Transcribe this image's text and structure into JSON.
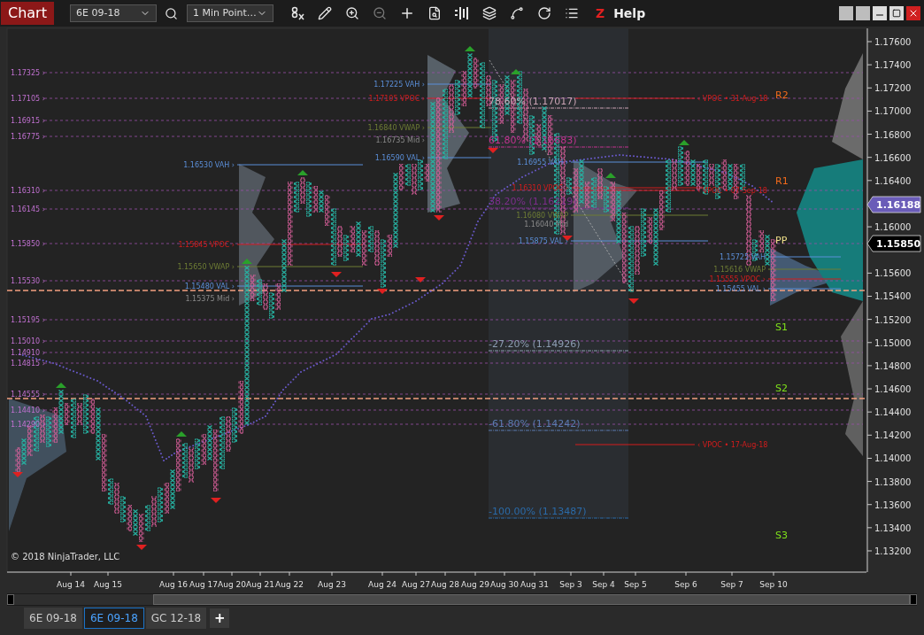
{
  "toolbar": {
    "title": "Chart",
    "instrument": "6E 09-18",
    "interval": "1 Min Point…",
    "menu_mark": "Z",
    "help": "Help"
  },
  "levels": [
    {
      "label": "1.17325 ›"
    },
    {
      "label": "1.17105 ›"
    },
    {
      "label": "1.16915 ›"
    },
    {
      "label": "1.16775 ›"
    },
    {
      "label": "1.16310 ›"
    },
    {
      "label": "1.16145 ›"
    },
    {
      "label": "1.15850 ›"
    },
    {
      "label": "1.15530 ›"
    },
    {
      "label": "1.15195 ›"
    },
    {
      "label": "1.15010 ›"
    },
    {
      "label": "1.14910 ›"
    },
    {
      "label": "1.14815 ›"
    },
    {
      "label": "1.14555 ›"
    },
    {
      "label": "1.14410 ›"
    },
    {
      "label": "1.14290 ›"
    }
  ],
  "sessions": [
    {
      "labels": [
        {
          "kind": "vah",
          "text": "1.16530 VAH ›"
        },
        {
          "kind": "vpoc",
          "text": "1.15845 VPOC ›"
        },
        {
          "kind": "vwap",
          "text": "1.15650 VWAP ›"
        },
        {
          "kind": "val",
          "text": "1.15480 VAL ›"
        },
        {
          "kind": "mid",
          "text": "1.15375 Mid ›"
        }
      ]
    },
    {
      "labels": [
        {
          "kind": "vah",
          "text": "1.17225 VAH ›"
        },
        {
          "kind": "vpoc",
          "text": "1.17105 VPOC ›"
        },
        {
          "kind": "vwap",
          "text": "1.16840 VWAP ›"
        },
        {
          "kind": "mid",
          "text": "1.16735 Mid ›"
        },
        {
          "kind": "val",
          "text": "1.16590 VAL ›"
        }
      ]
    },
    {
      "labels": [
        {
          "kind": "vah",
          "text": "1.16955 VAH ›"
        },
        {
          "kind": "vpoc",
          "text": "1.16310 VPOC ›"
        },
        {
          "kind": "vwap",
          "text": "1.16080 VWAP"
        },
        {
          "kind": "mid",
          "text": "1.16040 Mid"
        },
        {
          "kind": "val",
          "text": "1.15875 VAL ›"
        }
      ]
    },
    {
      "labels": [
        {
          "kind": "vah",
          "text": "1.15725 VAH"
        },
        {
          "kind": "vwap",
          "text": "1.15616 VWAP"
        },
        {
          "kind": "vpoc",
          "text": "1.15555 VPOC ›"
        },
        {
          "kind": "val",
          "text": "1.15455 VAL ›"
        }
      ]
    }
  ],
  "fib_levels": [
    {
      "text": "78.60% (1.17017)"
    },
    {
      "text": "61.80% (1.16683)"
    },
    {
      "text": "38.20% (1.16219)"
    },
    {
      "text": "-27.20% (1.14926)"
    },
    {
      "text": "-61.80% (1.14242)"
    },
    {
      "text": "-100.00% (1.13487)"
    }
  ],
  "naked_vpocs": [
    {
      "text": "‹ VPOC • 31-Aug-18"
    },
    {
      "text": "‹ VPOC • 07-Sep-18"
    },
    {
      "text": "‹ VPOC • 17-Aug-18"
    }
  ],
  "pivots": [
    {
      "kind": "resistance",
      "text": "R2"
    },
    {
      "kind": "resistance",
      "text": "R1"
    },
    {
      "kind": "pivot",
      "text": "PP"
    },
    {
      "kind": "support",
      "text": "S1"
    },
    {
      "kind": "support",
      "text": "S2"
    },
    {
      "kind": "support",
      "text": "S3"
    }
  ],
  "price_axis": {
    "ticks": [
      "1.17600",
      "1.17400",
      "1.17200",
      "1.17000",
      "1.16800",
      "1.16600",
      "1.16400",
      "1.16000",
      "1.15600",
      "1.15400",
      "1.15200",
      "1.15000",
      "1.14800",
      "1.14600",
      "1.14400",
      "1.14200",
      "1.14000",
      "1.13800",
      "1.13600",
      "1.13400",
      "1.13200"
    ],
    "markers": [
      {
        "kind": "last",
        "text": "1.16188"
      },
      {
        "kind": "level",
        "text": "1.15850"
      }
    ]
  },
  "time_axis": {
    "labels": [
      "Aug 14",
      "Aug 15",
      "Aug 16",
      "Aug 17",
      "Aug 20",
      "Aug 21",
      "Aug 22",
      "Aug 23",
      "Aug 24",
      "Aug 27",
      "Aug 28",
      "Aug 29",
      "Aug 30",
      "Aug 31",
      "Sep 3",
      "Sep 4",
      "Sep 5",
      "Sep 6",
      "Sep 7",
      "Sep 10"
    ]
  },
  "copyright": "© 2018 NinjaTrader, LLC",
  "tabs": [
    {
      "label": "6E 09-18",
      "selected": false
    },
    {
      "label": "6E 09-18",
      "selected": true
    },
    {
      "label": "GC 12-18",
      "selected": false
    }
  ],
  "add_tab": "+"
}
